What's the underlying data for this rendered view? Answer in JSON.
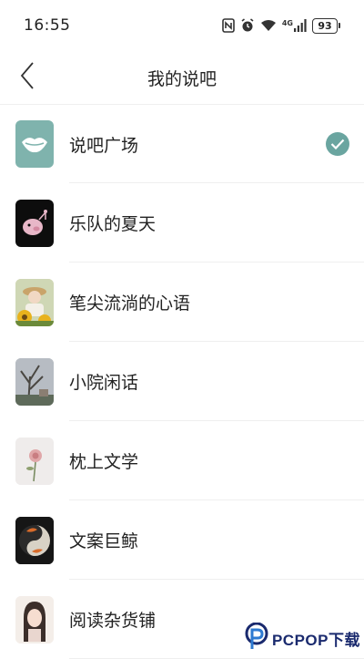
{
  "status_bar": {
    "time": "16:55",
    "network_type": "4G",
    "battery_level": "93",
    "icons": [
      "nfc-icon",
      "alarm-icon",
      "wifi-icon",
      "signal-icon",
      "battery-icon"
    ]
  },
  "nav": {
    "title": "我的说吧",
    "back_icon": "chevron-left-icon"
  },
  "list": {
    "items": [
      {
        "label": "说吧广场",
        "selected": true,
        "avatar": "lips-logo"
      },
      {
        "label": "乐队的夏天",
        "selected": false,
        "avatar": "pig-logo"
      },
      {
        "label": "笔尖流淌的心语",
        "selected": false,
        "avatar": "sunflower-photo"
      },
      {
        "label": "小院闲话",
        "selected": false,
        "avatar": "tree-photo"
      },
      {
        "label": "枕上文学",
        "selected": false,
        "avatar": "rose-photo"
      },
      {
        "label": "文案巨鲸",
        "selected": false,
        "avatar": "koi-photo"
      },
      {
        "label": "阅读杂货铺",
        "selected": false,
        "avatar": "girl-illustration"
      }
    ]
  },
  "colors": {
    "accent": "#6aa5a0",
    "text": "#222222",
    "divider": "#efefef"
  },
  "watermark": {
    "text": "PCPOP下载"
  }
}
